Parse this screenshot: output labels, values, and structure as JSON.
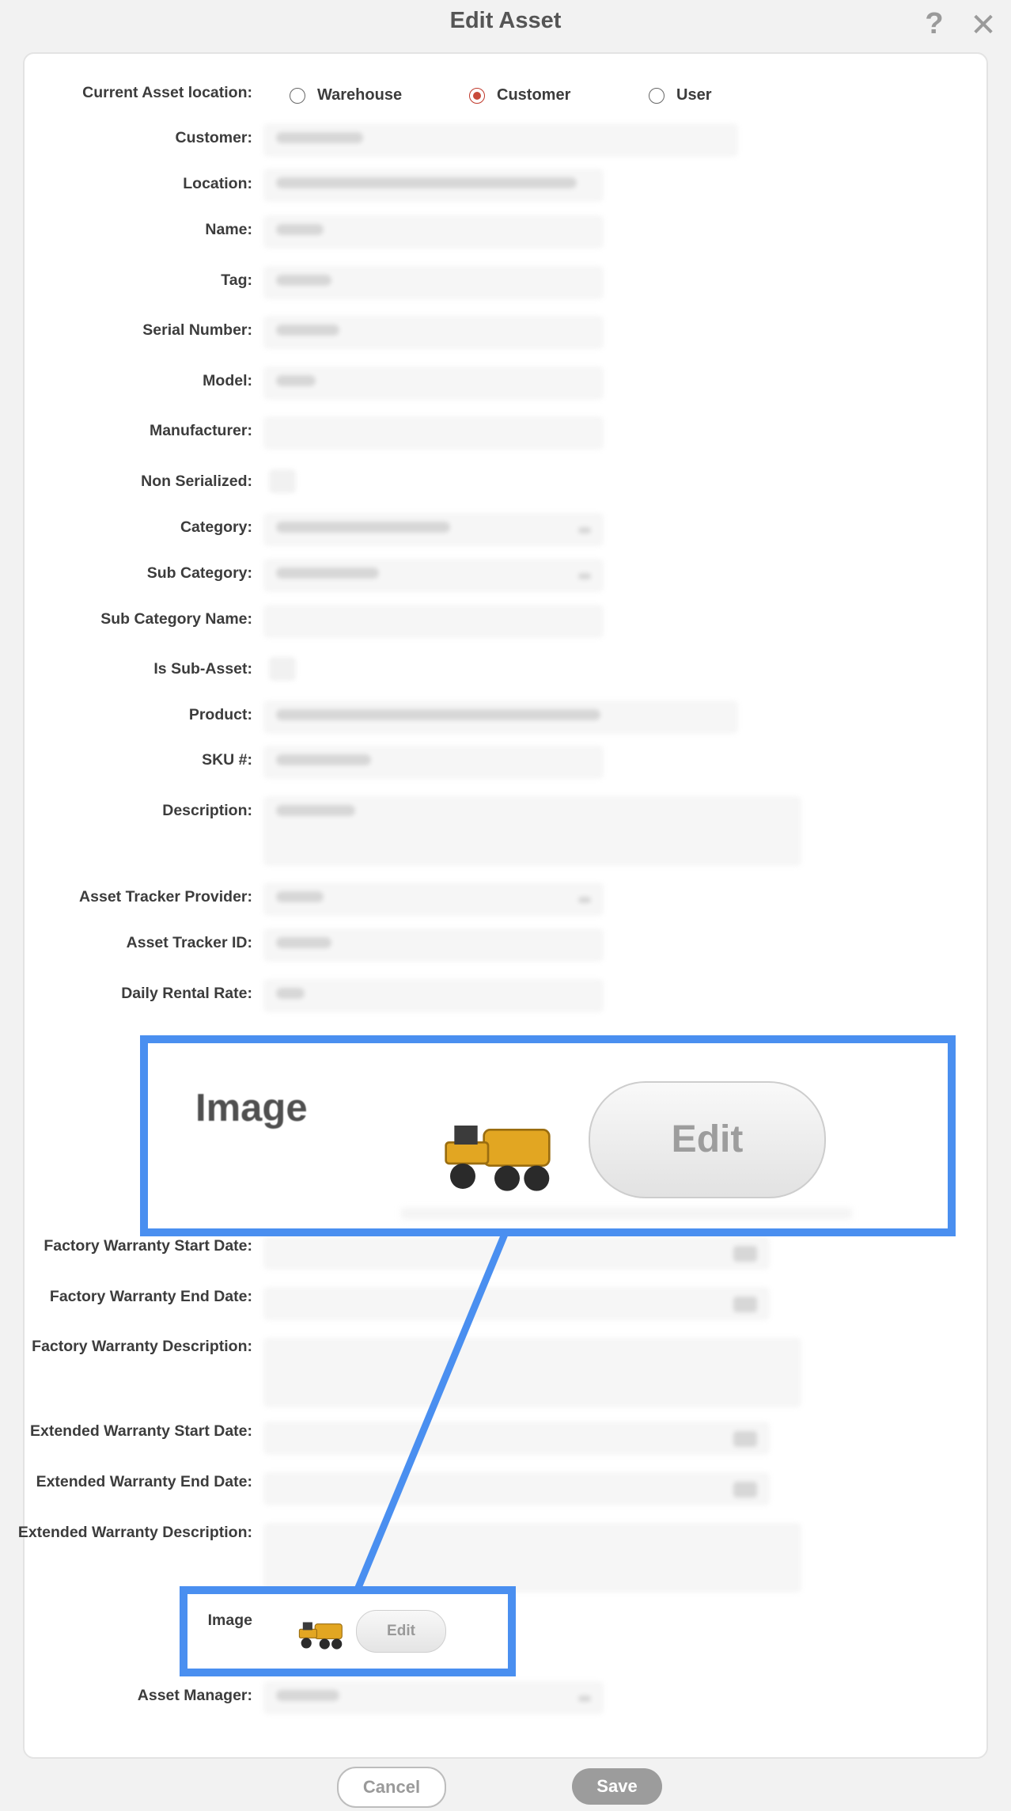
{
  "window": {
    "title": "Edit Asset",
    "help_icon": "help-icon",
    "close_icon": "close-icon"
  },
  "colors": {
    "highlight": "#4a8ff0",
    "radio_selected": "#c84a3a",
    "save_button": "#9c9c9c"
  },
  "location": {
    "label": "Current Asset location:",
    "options": [
      "Warehouse",
      "Customer",
      "User"
    ],
    "selected": "Customer"
  },
  "labels": {
    "customer": "Customer:",
    "location": "Location:",
    "name": "Name:",
    "tag": "Tag:",
    "serial": "Serial Number:",
    "model": "Model:",
    "manufacturer": "Manufacturer:",
    "non_serialized": "Non Serialized:",
    "category": "Category:",
    "sub_category": "Sub Category:",
    "sub_category_name": "Sub Category Name:",
    "is_sub_asset": "Is Sub-Asset:",
    "product": "Product:",
    "sku": "SKU #:",
    "description": "Description:",
    "tracker_provider": "Asset Tracker Provider:",
    "tracker_id": "Asset Tracker ID:",
    "daily_rental_rate": "Daily Rental Rate:",
    "man_partial": "Man",
    "factory_warranty_start": "Factory Warranty Start Date:",
    "factory_warranty_end": "Factory Warranty End Date:",
    "factory_warranty_description": "Factory Warranty Description:",
    "extended_warranty_start": "Extended Warranty Start Date:",
    "extended_warranty_end": "Extended Warranty End Date:",
    "extended_warranty_description": "Extended Warranty Description:",
    "image": "Image",
    "asset_manager": "Asset Manager:"
  },
  "image": {
    "thumbnail_icon": "articulated-dump-truck",
    "edit_label": "Edit"
  },
  "zoom": {
    "label": "Image",
    "edit_label": "Edit"
  },
  "footer": {
    "cancel_label": "Cancel",
    "save_label": "Save"
  }
}
